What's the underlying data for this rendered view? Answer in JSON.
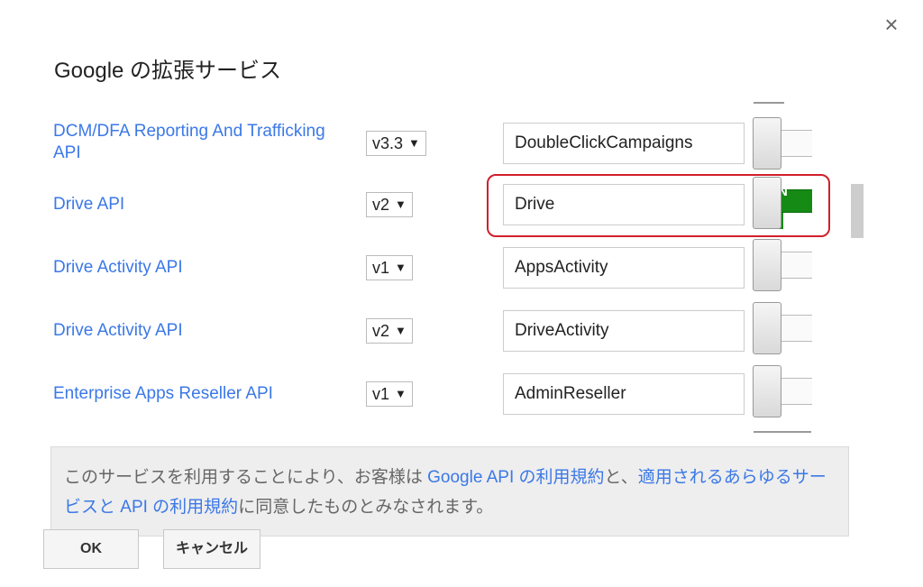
{
  "dialog": {
    "title": "Google の拡張サービス",
    "close_label": "×"
  },
  "services": [
    {
      "name": "DCM/DFA Reporting And Trafficking API",
      "version": "v3.3",
      "identifier": "DoubleClickCampaigns",
      "enabled": false
    },
    {
      "name": "Drive API",
      "version": "v2",
      "identifier": "Drive",
      "enabled": true
    },
    {
      "name": "Drive Activity API",
      "version": "v1",
      "identifier": "AppsActivity",
      "enabled": false
    },
    {
      "name": "Drive Activity API",
      "version": "v2",
      "identifier": "DriveActivity",
      "enabled": false
    },
    {
      "name": "Enterprise Apps Reseller API",
      "version": "v1",
      "identifier": "AdminReseller",
      "enabled": false
    }
  ],
  "toggle_on_text": "N",
  "dropdown_arrow": "▼",
  "notice": {
    "text_1": "このサービスを利用することにより、お客様は ",
    "link_1": "Google API の利用規約",
    "text_2": "と、",
    "link_2": "適用されるあらゆるサービスと API の利用規約",
    "text_3": "に同意したものとみなされます。"
  },
  "buttons": {
    "ok": "OK",
    "cancel": "キャンセル"
  },
  "colors": {
    "link": "#3b78e7",
    "toggle_on": "#158a15",
    "highlight": "#d21f2b"
  }
}
